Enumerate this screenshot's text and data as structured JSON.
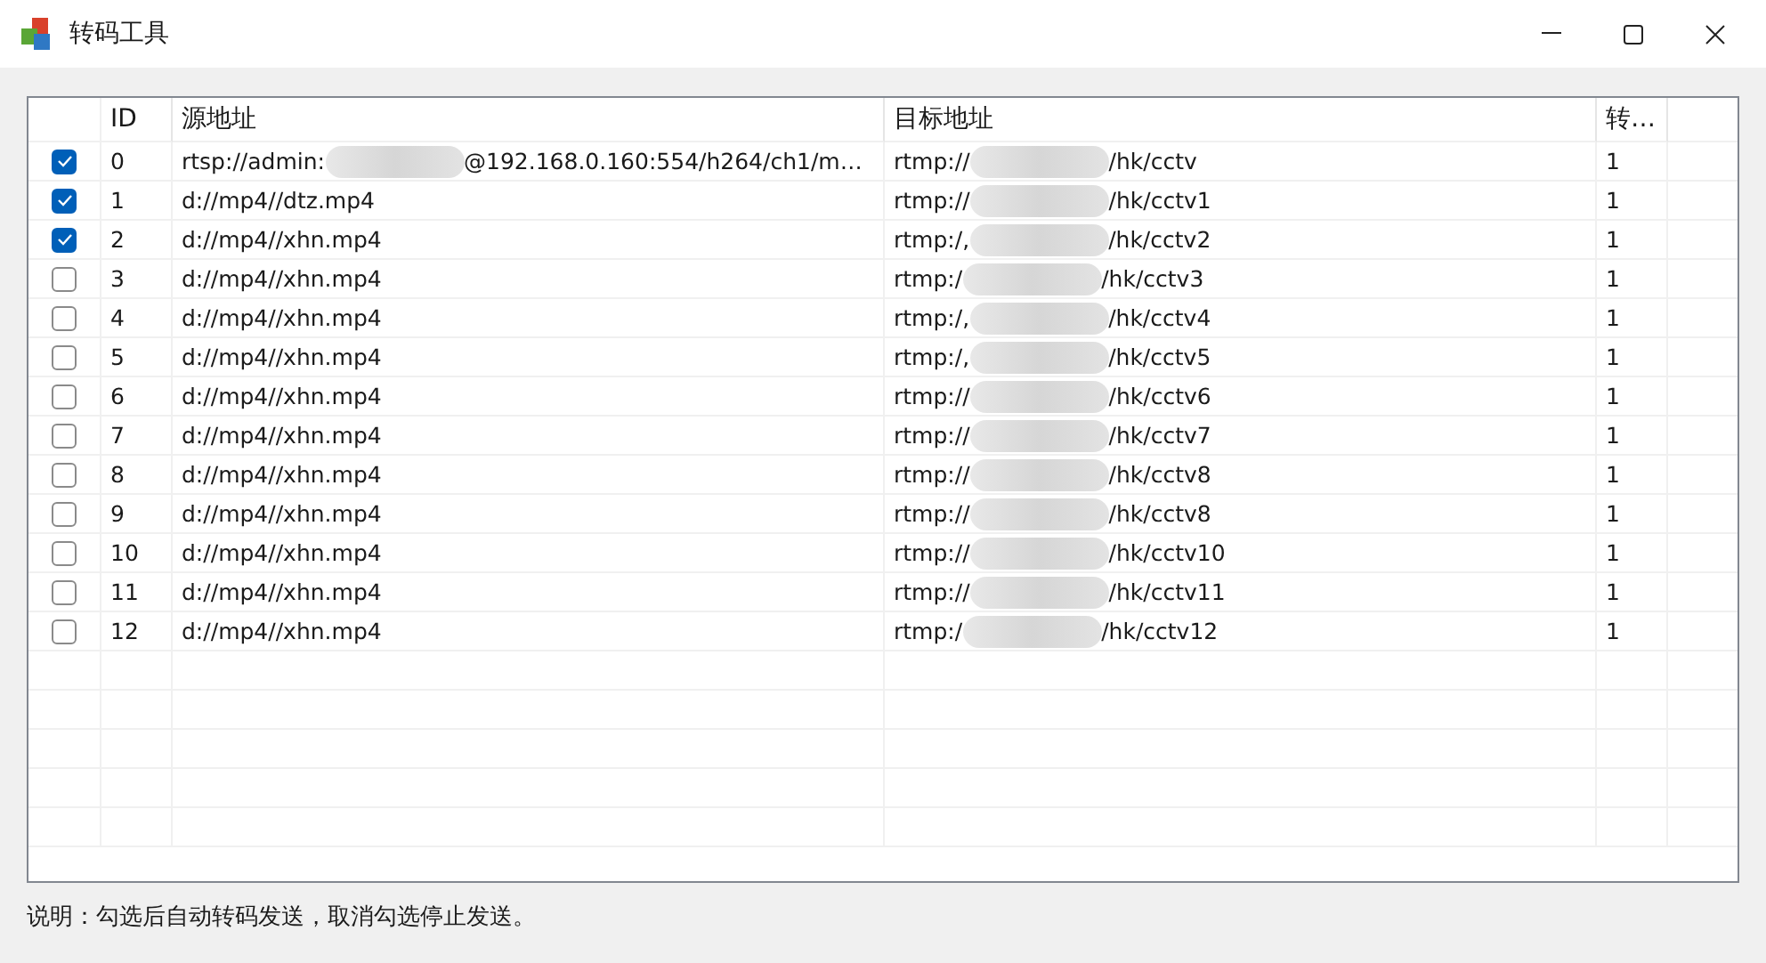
{
  "window": {
    "title": "转码工具"
  },
  "table": {
    "columns": [
      "ID",
      "源地址",
      "目标地址",
      "转…"
    ],
    "rows": [
      {
        "checked": true,
        "id": "0",
        "source": [
          "rtsp://admin:",
          "@192.168.0.160:554/h264/ch1/m…"
        ],
        "target": [
          "rtmp://",
          "/hk/cctv"
        ],
        "col4": "1"
      },
      {
        "checked": true,
        "id": "1",
        "source": [
          "d://mp4//dtz.mp4"
        ],
        "target": [
          "rtmp://",
          "/hk/cctv1"
        ],
        "col4": "1"
      },
      {
        "checked": true,
        "id": "2",
        "source": [
          "d://mp4//xhn.mp4"
        ],
        "target": [
          "rtmp:/,",
          "/hk/cctv2"
        ],
        "col4": "1"
      },
      {
        "checked": false,
        "id": "3",
        "source": [
          "d://mp4//xhn.mp4"
        ],
        "target": [
          "rtmp:/",
          "/hk/cctv3"
        ],
        "col4": "1"
      },
      {
        "checked": false,
        "id": "4",
        "source": [
          "d://mp4//xhn.mp4"
        ],
        "target": [
          "rtmp:/,",
          "/hk/cctv4"
        ],
        "col4": "1"
      },
      {
        "checked": false,
        "id": "5",
        "source": [
          "d://mp4//xhn.mp4"
        ],
        "target": [
          "rtmp:/,",
          "/hk/cctv5"
        ],
        "col4": "1"
      },
      {
        "checked": false,
        "id": "6",
        "source": [
          "d://mp4//xhn.mp4"
        ],
        "target": [
          "rtmp://",
          "/hk/cctv6"
        ],
        "col4": "1"
      },
      {
        "checked": false,
        "id": "7",
        "source": [
          "d://mp4//xhn.mp4"
        ],
        "target": [
          "rtmp://",
          "/hk/cctv7"
        ],
        "col4": "1"
      },
      {
        "checked": false,
        "id": "8",
        "source": [
          "d://mp4//xhn.mp4"
        ],
        "target": [
          "rtmp://",
          "/hk/cctv8"
        ],
        "col4": "1"
      },
      {
        "checked": false,
        "id": "9",
        "source": [
          "d://mp4//xhn.mp4"
        ],
        "target": [
          "rtmp://",
          "/hk/cctv8"
        ],
        "col4": "1"
      },
      {
        "checked": false,
        "id": "10",
        "source": [
          "d://mp4//xhn.mp4"
        ],
        "target": [
          "rtmp://",
          "/hk/cctv10"
        ],
        "col4": "1"
      },
      {
        "checked": false,
        "id": "11",
        "source": [
          "d://mp4//xhn.mp4"
        ],
        "target": [
          "rtmp://",
          "/hk/cctv11"
        ],
        "col4": "1"
      },
      {
        "checked": false,
        "id": "12",
        "source": [
          "d://mp4//xhn.mp4"
        ],
        "target": [
          "rtmp:/",
          "/hk/cctv12"
        ],
        "col4": "1"
      }
    ]
  },
  "note": "说明：勾选后自动转码发送，取消勾选停止发送。"
}
